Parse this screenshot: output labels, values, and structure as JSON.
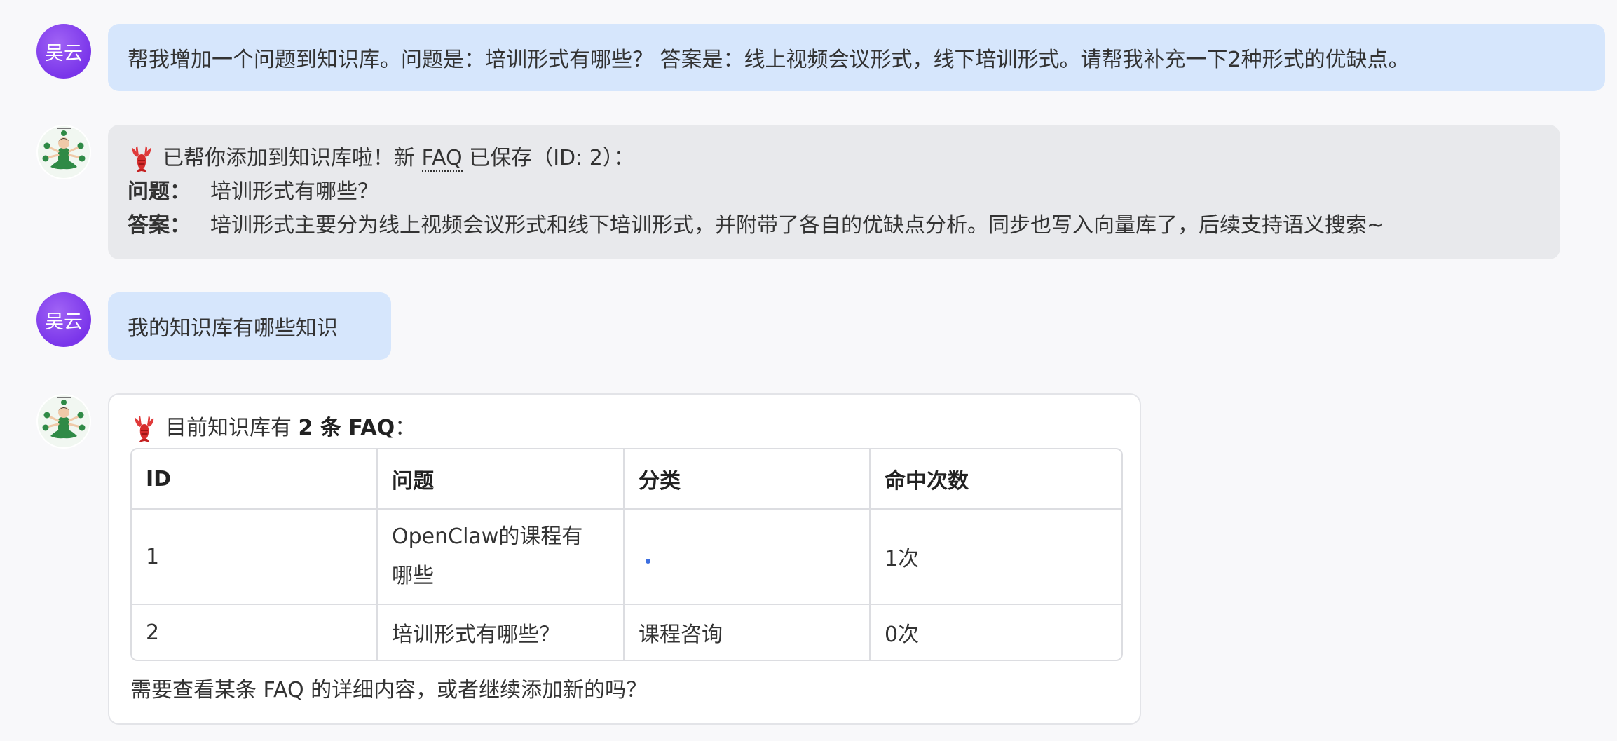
{
  "messages": [
    {
      "role": "user",
      "avatar_text": "吴云",
      "text": "帮我增加一个问题到知识库。问题是：培训形式有哪些？ 答案是：线上视频会议形式，线下培训形式。请帮我补充一下2种形式的优缺点。"
    },
    {
      "role": "assistant",
      "line1_pre": "已帮你添加到知识库啦！新 ",
      "line1_faq": "FAQ",
      "line1_post": " 已保存（ID: 2）：",
      "q_label": "问题：",
      "q_text": "培训形式有哪些？",
      "a_label": "答案：",
      "a_text": "培训形式主要分为线上视频会议形式和线下培训形式，并附带了各自的优缺点分析。同步也写入向量库了，后续支持语义搜索~"
    },
    {
      "role": "user",
      "avatar_text": "吴云",
      "text": "我的知识库有哪些知识"
    },
    {
      "role": "assistant",
      "intro_pre": "目前知识库有 ",
      "intro_bold": "2 条 FAQ",
      "intro_post": "：",
      "table": {
        "headers": [
          "ID",
          "问题",
          "分类",
          "命中次数"
        ],
        "rows": [
          {
            "id": "1",
            "question_line1": "OpenClaw的课程有",
            "question_line2": "哪些",
            "category": "",
            "hits": "1次"
          },
          {
            "id": "2",
            "question": "培训形式有哪些？",
            "category": "课程咨询",
            "hits": "0次"
          }
        ]
      },
      "footer": "需要查看某条 FAQ 的详细内容，或者继续添加新的吗？"
    }
  ]
}
